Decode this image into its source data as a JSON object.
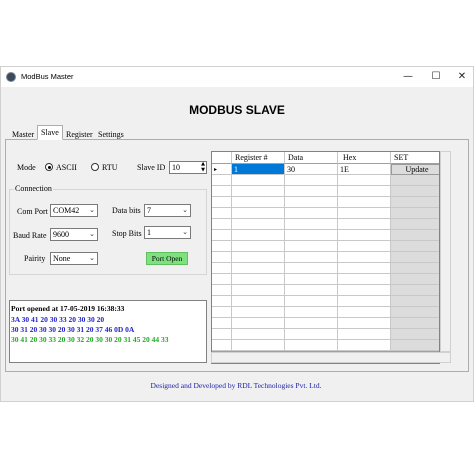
{
  "window": {
    "title": "ModBus Master",
    "minimize": "—",
    "maximize": "☐",
    "close": "✕"
  },
  "page_title": "MODBUS SLAVE",
  "tabs": [
    {
      "label": "Master"
    },
    {
      "label": "Slave",
      "active": true
    },
    {
      "label": "Register"
    },
    {
      "label": "Settings"
    }
  ],
  "mode": {
    "label": "Mode",
    "options": [
      "ASCII",
      "RTU"
    ],
    "selected": "ASCII"
  },
  "slave_id": {
    "label": "Slave ID",
    "value": "10"
  },
  "connection": {
    "legend": "Connection",
    "com_port": {
      "label": "Com Port",
      "value": "COM42"
    },
    "data_bits": {
      "label": "Data bits",
      "value": "7"
    },
    "baud_rate": {
      "label": "Baud Rate",
      "value": "9600"
    },
    "stop_bits": {
      "label": "Stop Bits",
      "value": "1"
    },
    "pairity": {
      "label": "Pairity",
      "value": "None"
    },
    "port_button": {
      "label": "Port Open",
      "color": "#7fe07f"
    }
  },
  "log": [
    {
      "text": "Port opened at 17-05-2019 16:38:33",
      "color": "#000000"
    },
    {
      "text": "3A 30 41 20 30 33 20 30 30 20",
      "color": "#2222cc"
    },
    {
      "text": "30 31 20 30 30 20 30 31 20 37 46 0D 0A",
      "color": "#2222cc"
    },
    {
      "text": "30 41 20 30 33 20 30 32 20 30 30 20 31 45 20 44 33",
      "color": "#22aa22"
    }
  ],
  "grid": {
    "columns": [
      "Register #",
      "Data",
      "Hex",
      "SET"
    ],
    "rows": [
      {
        "register": "1",
        "data": "30",
        "hex": "1E",
        "set": "Update"
      }
    ],
    "current_row_marker": "▸",
    "selection_color": "#0078d7"
  },
  "footer": "Designed and Developed by RDL Technologies Pvt. Ltd."
}
